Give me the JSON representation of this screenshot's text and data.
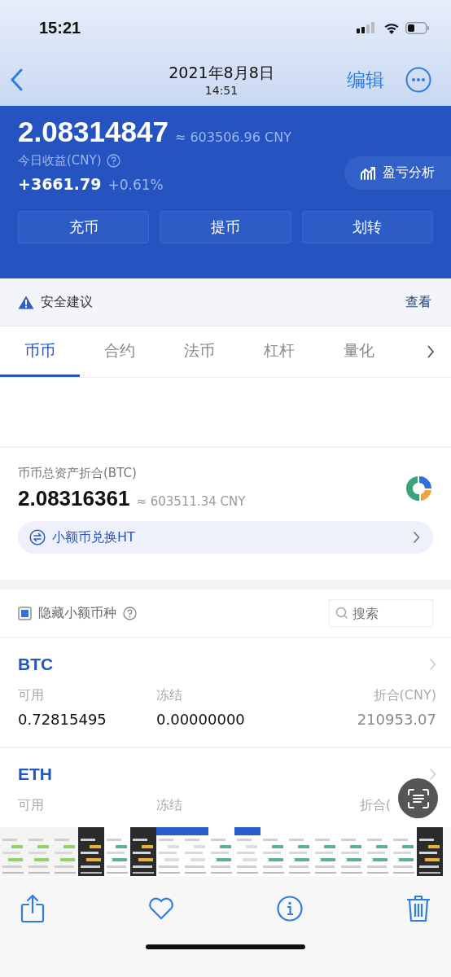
{
  "status_bar": {
    "time": "15:21"
  },
  "nav": {
    "title": "2021年8月8日",
    "subtitle": "14:51",
    "edit": "编辑"
  },
  "account": {
    "balance": "2.08314847",
    "balance_cny": "≈ 603506.96 CNY",
    "income_label": "今日收益(CNY)",
    "income": "+3661.79",
    "income_pct": "+0.61%",
    "analysis": "盈亏分析",
    "actions": [
      "充币",
      "提币",
      "划转"
    ]
  },
  "notice": {
    "text": "安全建议",
    "link": "查看"
  },
  "tabs": [
    {
      "label": "币币",
      "selected": true
    },
    {
      "label": "合约",
      "selected": false
    },
    {
      "label": "法币",
      "selected": false
    },
    {
      "label": "杠杆",
      "selected": false
    },
    {
      "label": "量化",
      "selected": false
    }
  ],
  "summary": {
    "label": "币币总资产折合(BTC)",
    "value": "2.08316361",
    "value_cny": "≈ 603511.34 CNY",
    "convert": "小额币兑换HT"
  },
  "filter": {
    "label": "隐藏小额币种",
    "checked": true,
    "search_placeholder": "搜索"
  },
  "coins": [
    {
      "symbol": "BTC",
      "columns": [
        {
          "label": "可用",
          "value": "0.72815495"
        },
        {
          "label": "冻结",
          "value": "0.00000000"
        },
        {
          "label": "折合(CNY)",
          "value": "210953.07"
        }
      ]
    },
    {
      "symbol": "ETH",
      "columns": [
        {
          "label": "可用"
        },
        {
          "label": "冻结"
        },
        {
          "label": "折合("
        }
      ]
    }
  ]
}
